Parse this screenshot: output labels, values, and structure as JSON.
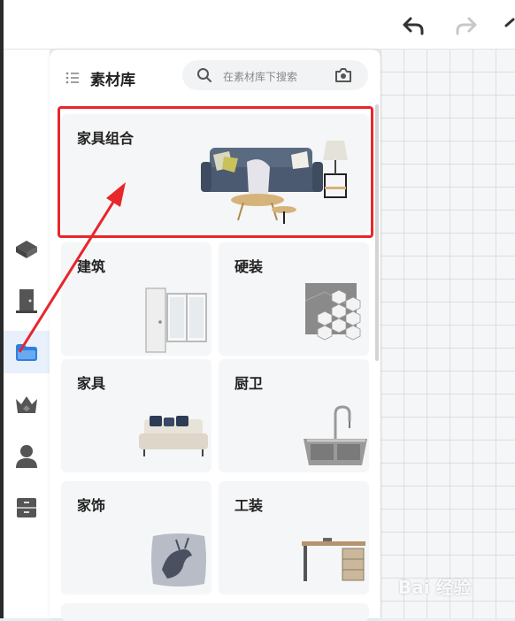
{
  "panel": {
    "title": "素材库",
    "search_placeholder": "在素材库下搜索"
  },
  "categories": [
    {
      "label": "家具组合"
    },
    {
      "label": "建筑"
    },
    {
      "label": "硬装"
    },
    {
      "label": "家具"
    },
    {
      "label": "厨卫"
    },
    {
      "label": "家饰"
    },
    {
      "label": "工装"
    }
  ],
  "icons": {
    "undo": "undo-icon",
    "redo": "redo-icon",
    "search": "search-icon",
    "camera": "camera-icon",
    "menu": "list-icon"
  },
  "colors": {
    "highlight": "#e8262b",
    "active_rail": "#2f7fe0"
  },
  "watermark": "Bai 经验"
}
